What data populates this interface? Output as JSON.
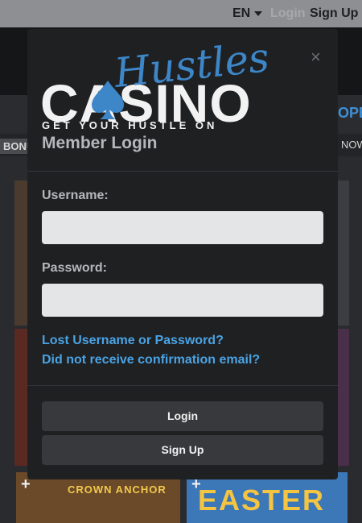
{
  "topbar": {
    "language": "EN",
    "login_label": "Login",
    "signup_label": "Sign Up"
  },
  "background": {
    "promo_text": "OPE",
    "bonus_tab": "BONU",
    "now_tab": "NOW",
    "tile_left_bottom": "CROWN ANCHOR",
    "tile_right_bottom": "EASTER"
  },
  "modal": {
    "logo_script": "Hustles",
    "logo_word": "CASINO",
    "logo_tagline": "GET YOUR HUSTLE ON",
    "title": "Member Login",
    "close_label": "×",
    "username_label": "Username:",
    "username_value": "",
    "username_placeholder": "",
    "password_label": "Password:",
    "password_value": "",
    "password_placeholder": "",
    "lost_link": "Lost Username or Password?",
    "confirm_link": "Did not receive confirmation email?",
    "login_button": "Login",
    "signup_button": "Sign Up"
  },
  "colors": {
    "accent": "#4aa3e4",
    "modal_bg": "#1f2022",
    "button_bg": "#38393c"
  }
}
